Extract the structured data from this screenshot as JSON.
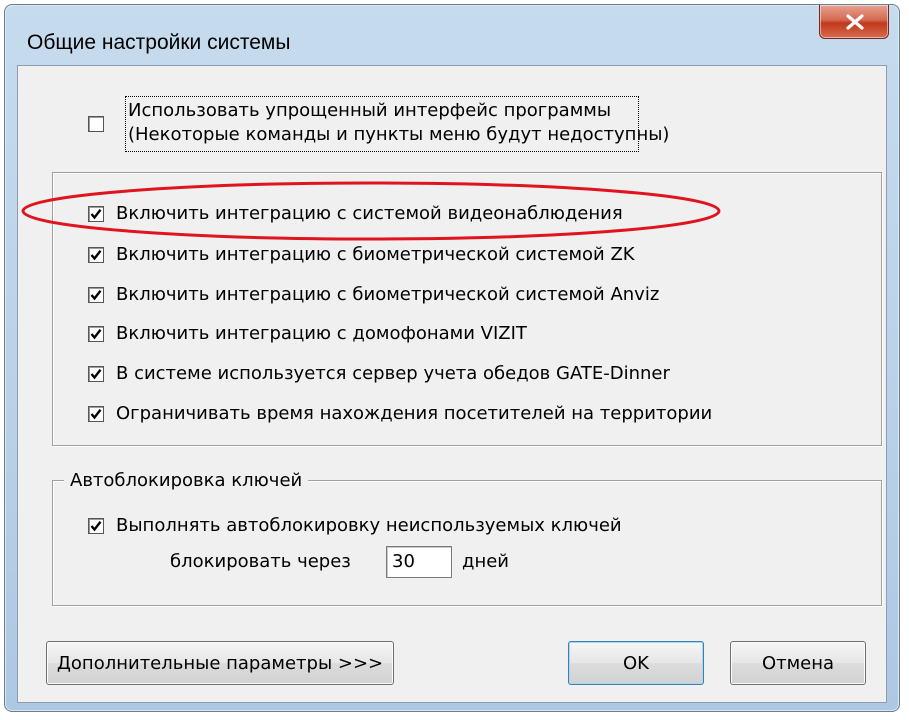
{
  "window": {
    "title": "Общие настройки системы"
  },
  "simplified": {
    "checked": false,
    "label_line1": "Использовать упрощенный интерфейс программы",
    "label_line2": "(Некоторые команды и пункты меню будут недоступны)"
  },
  "integrations": [
    {
      "label": "Включить интеграцию с системой видеонаблюдения",
      "checked": true
    },
    {
      "label": "Включить интеграцию с биометрической системой ZK",
      "checked": true
    },
    {
      "label": "Включить интеграцию с биометрической системой Anviz",
      "checked": true
    },
    {
      "label": "Включить интеграцию с домофонами VIZIT",
      "checked": true
    },
    {
      "label": "В системе используется сервер учета обедов GATE-Dinner",
      "checked": true
    },
    {
      "label": "Ограничивать время нахождения посетителей на территории",
      "checked": true
    }
  ],
  "autoblock": {
    "group_title": "Автоблокировка ключей",
    "enable_label": "Выполнять автоблокировку неиспользуемых ключей",
    "enable_checked": true,
    "after_label": "блокировать через",
    "days_value": "30",
    "days_unit": "дней"
  },
  "buttons": {
    "advanced": "Дополнительные параметры >>>",
    "ok": "OK",
    "cancel": "Отмена"
  },
  "colors": {
    "highlight_ellipse": "#e0141e",
    "close_button": "#c1391b"
  },
  "icons": {
    "close": "close-icon",
    "check": "check-icon"
  }
}
